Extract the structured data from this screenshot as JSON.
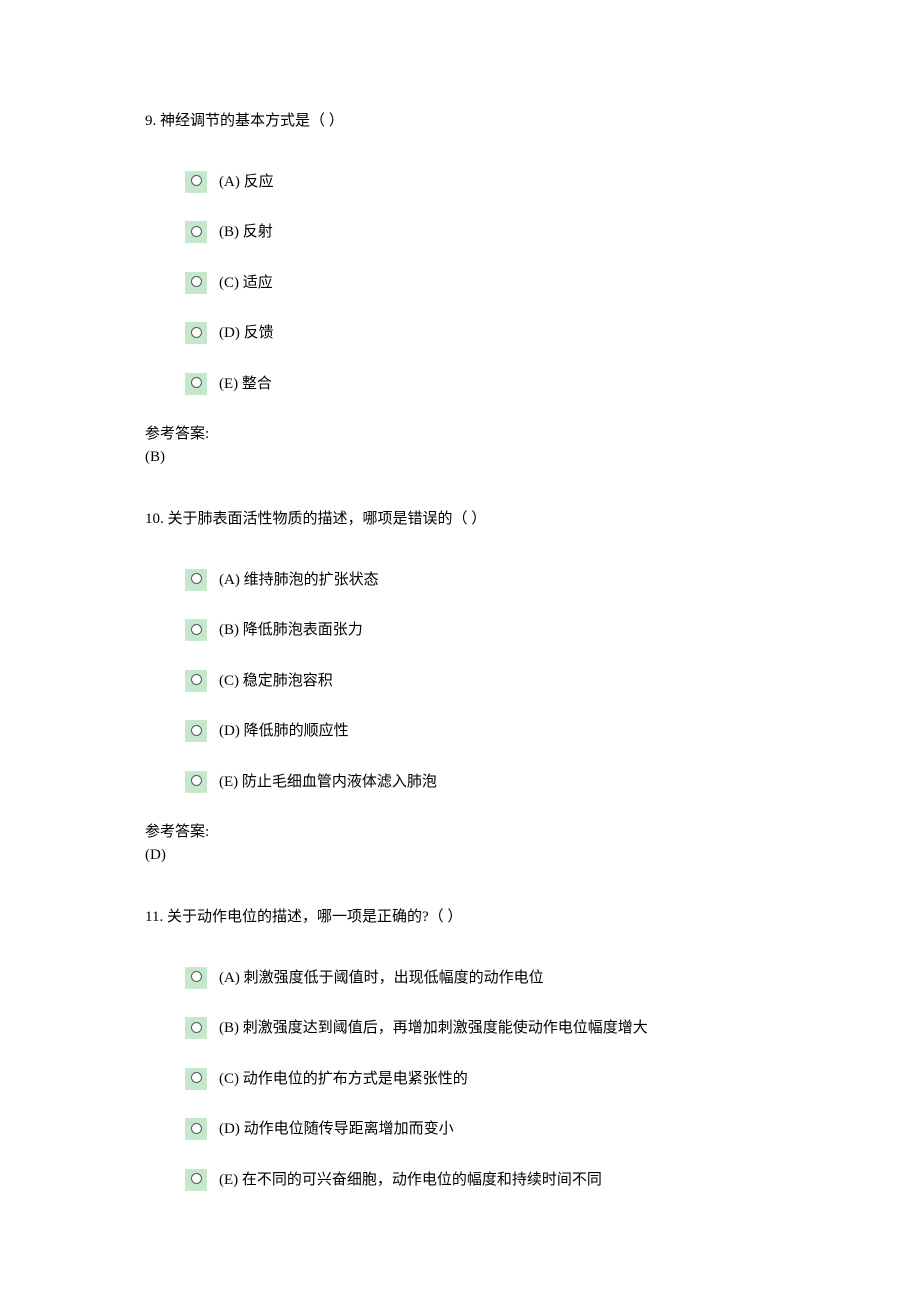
{
  "questions": [
    {
      "number": "9.",
      "text": "神经调节的基本方式是（ ）",
      "options": [
        {
          "key": "(A)",
          "label": "反应"
        },
        {
          "key": "(B)",
          "label": "反射"
        },
        {
          "key": "(C)",
          "label": "适应"
        },
        {
          "key": "(D)",
          "label": "反馈"
        },
        {
          "key": "(E)",
          "label": "整合"
        }
      ],
      "answer_label": "参考答案:",
      "answer": "(B)"
    },
    {
      "number": "10.",
      "text": "关于肺表面活性物质的描述，哪项是错误的（ ）",
      "options": [
        {
          "key": "(A)",
          "label": "维持肺泡的扩张状态"
        },
        {
          "key": "(B)",
          "label": "降低肺泡表面张力"
        },
        {
          "key": "(C)",
          "label": "稳定肺泡容积"
        },
        {
          "key": "(D)",
          "label": "降低肺的顺应性"
        },
        {
          "key": "(E)",
          "label": "防止毛细血管内液体滤入肺泡"
        }
      ],
      "answer_label": "参考答案:",
      "answer": "(D)"
    },
    {
      "number": "11.",
      "text": "关于动作电位的描述，哪一项是正确的?（ ）",
      "options": [
        {
          "key": "(A)",
          "label": "刺激强度低于阈值时，出现低幅度的动作电位"
        },
        {
          "key": "(B)",
          "label": "刺激强度达到阈值后，再增加刺激强度能使动作电位幅度增大"
        },
        {
          "key": "(C)",
          "label": "动作电位的扩布方式是电紧张性的"
        },
        {
          "key": "(D)",
          "label": "动作电位随传导距离增加而变小"
        },
        {
          "key": "(E)",
          "label": "在不同的可兴奋细胞，动作电位的幅度和持续时间不同"
        }
      ],
      "answer_label": "",
      "answer": ""
    }
  ]
}
